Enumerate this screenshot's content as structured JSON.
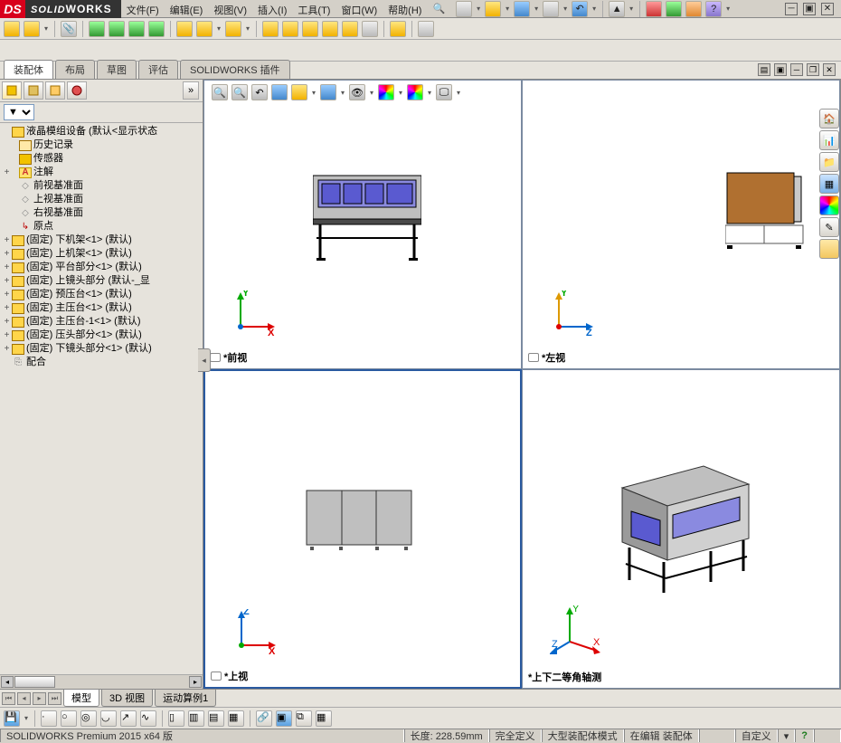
{
  "app": {
    "name_html": "SOLIDWORKS",
    "logo": "DS"
  },
  "menu": [
    "文件(F)",
    "编辑(E)",
    "视图(V)",
    "插入(I)",
    "工具(T)",
    "窗口(W)",
    "帮助(H)"
  ],
  "command_tabs": [
    "装配体",
    "布局",
    "草图",
    "评估",
    "SOLIDWORKS 插件"
  ],
  "active_command_tab": 0,
  "left_panel": {
    "filter_label": "▼",
    "root": "液晶模组设备  (默认<显示状态",
    "static_nodes": [
      {
        "icon": "folder",
        "label": "历史记录",
        "indent": 1,
        "expand": ""
      },
      {
        "icon": "box",
        "label": "传感器",
        "indent": 1,
        "expand": ""
      },
      {
        "icon": "anno",
        "label": "注解",
        "indent": 1,
        "expand": "+"
      },
      {
        "icon": "diamond",
        "label": "前视基准面",
        "indent": 1,
        "expand": ""
      },
      {
        "icon": "diamond",
        "label": "上视基准面",
        "indent": 1,
        "expand": ""
      },
      {
        "icon": "diamond",
        "label": "右视基准面",
        "indent": 1,
        "expand": ""
      },
      {
        "icon": "origin",
        "label": "原点",
        "indent": 1,
        "expand": ""
      }
    ],
    "components": [
      "(固定) 下机架<1> (默认)",
      "(固定) 上机架<1> (默认)",
      "(固定) 平台部分<1> (默认)",
      "(固定) 上镜头部分 (默认-_显",
      "(固定) 预压台<1> (默认)",
      "(固定) 主压台<1> (默认)",
      "(固定) 主压台-1<1> (默认)",
      "(固定) 压头部分<1> (默认)",
      "(固定) 下镜头部分<1> (默认)"
    ],
    "mates_label": "配合"
  },
  "viewports": {
    "front": {
      "title": "*前视",
      "axes": [
        "Y",
        "X"
      ]
    },
    "left": {
      "title": "*左视",
      "axes": [
        "Y",
        "Z"
      ]
    },
    "top": {
      "title": "*上视",
      "axes": [
        "Z",
        "X"
      ]
    },
    "iso": {
      "title": "*上下二等角轴测",
      "axes": [
        "Y",
        "X",
        "Z"
      ]
    }
  },
  "bottom_tabs": [
    "模型",
    "3D 视图",
    "运动算例1"
  ],
  "status": {
    "product": "SOLIDWORKS Premium 2015 x64 版",
    "length": "长度: 228.59mm",
    "defined": "完全定义",
    "mode": "大型装配体模式",
    "editing": "在编辑 装配体",
    "custom": "自定义"
  }
}
